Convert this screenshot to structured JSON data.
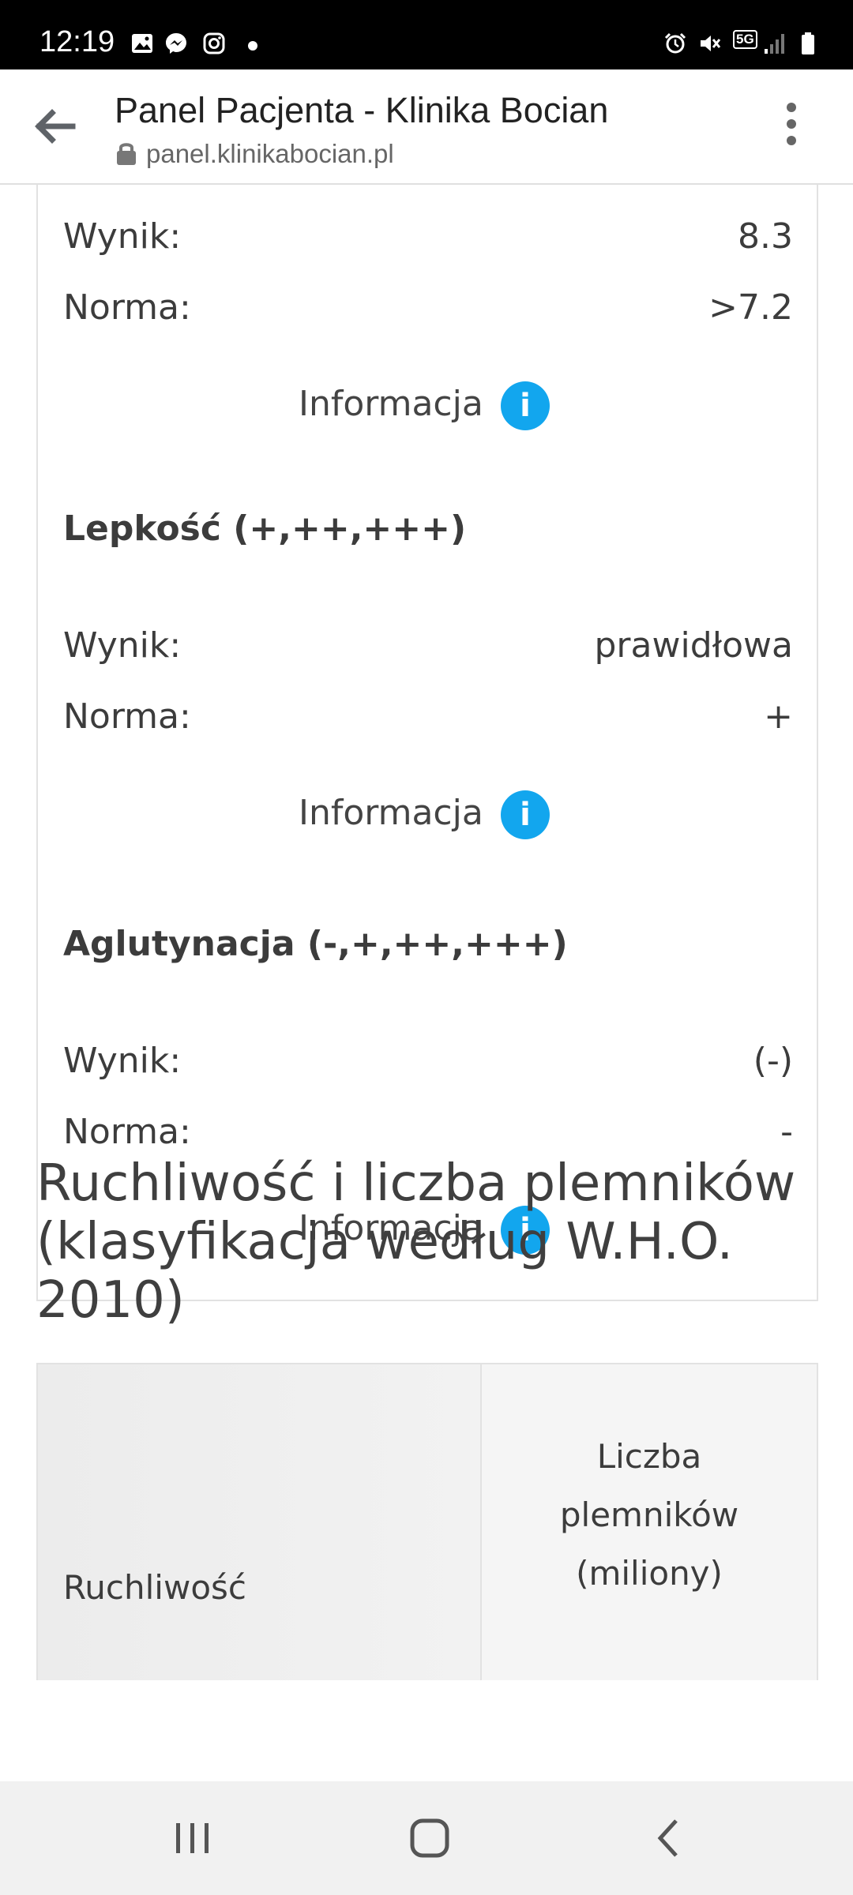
{
  "status_bar": {
    "time": "12:19",
    "left_icons": [
      "gallery-icon",
      "messenger-icon",
      "instagram-icon",
      "notification-dot"
    ],
    "right_icons": [
      "alarm-icon",
      "mute-icon",
      "5g-icon",
      "signal-icon",
      "battery-icon"
    ],
    "network_label": "5G"
  },
  "browser": {
    "title": "Panel Pacjenta - Klinika Bocian",
    "url": "panel.klinikabocian.pl"
  },
  "cards": [
    {
      "heading": "",
      "result_label": "Wynik:",
      "result_value": "8.3",
      "norm_label": "Norma:",
      "norm_value": ">7.2",
      "info_label": "Informacja",
      "info_icon": "i"
    },
    {
      "heading": "Lepkość (+,++,+++)",
      "result_label": "Wynik:",
      "result_value": "prawidłowa",
      "norm_label": "Norma:",
      "norm_value": "+",
      "info_label": "Informacja",
      "info_icon": "i"
    },
    {
      "heading": "Aglutynacja (-,+,++,+++)",
      "result_label": "Wynik:",
      "result_value": "(-)",
      "norm_label": "Norma:",
      "norm_value": "-",
      "info_label": "Informacja",
      "info_icon": "i"
    }
  ],
  "section": {
    "title_line1": "Ruchliwość i liczba plemników",
    "title_line2": "(klasyfikacja według W.H.O.",
    "title_line3": "2010)"
  },
  "table": {
    "col1_header": "Ruchliwość",
    "col2_header_line1": "Liczba",
    "col2_header_line2": "plemników",
    "col2_header_line3": "(miliony)"
  },
  "colors": {
    "info_button": "#12a6ee",
    "status_bar": "#000000",
    "nav_bar": "#f1f1f1"
  }
}
